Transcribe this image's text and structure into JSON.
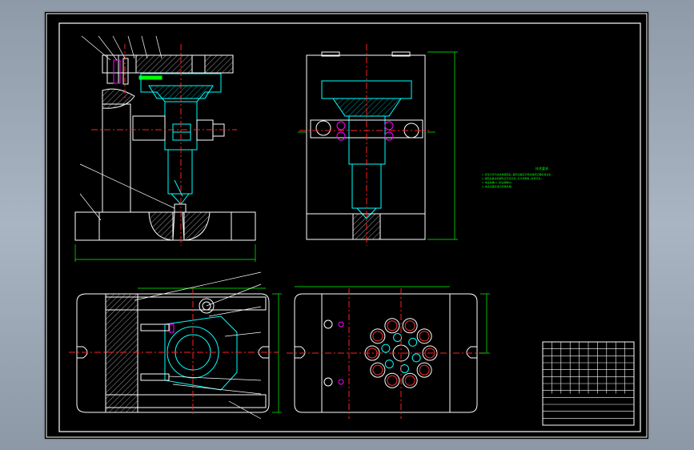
{
  "colors": {
    "background": "#98a4b3",
    "sheet": "#000000",
    "outline": "#ffffff",
    "hidden": "#00ffff",
    "center": "#ff2020",
    "dimension": "#00ff00",
    "highlight": "#ff00ff",
    "leader": "#ffffff"
  },
  "tech_requirements": {
    "title": "技术要求",
    "lines": [
      "1.定位元件与夹具体装配后,其定位面应平整并保持正确位置关系;",
      "2.装配后各运动部件应灵活可靠,无卡滞现象,夹紧可靠;",
      "3.未注倒角C1,未注圆角R2;",
      "4.夹具表面应进行防锈处理。"
    ]
  },
  "title_block": {
    "rows": 12,
    "cols": 10
  }
}
